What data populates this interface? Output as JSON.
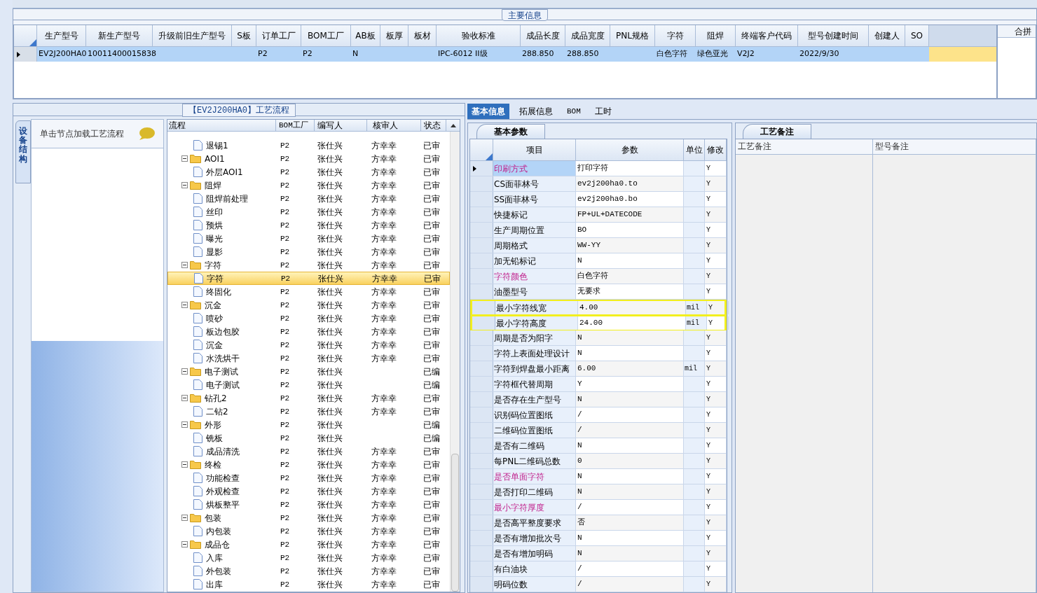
{
  "main_info": {
    "title": "主要信息",
    "columns": [
      {
        "label": "生产型号",
        "value": "EV2J200HA0"
      },
      {
        "label": "新生产型号",
        "value": "10011400015838"
      },
      {
        "label": "升级前旧生产型号"
      },
      {
        "label": "S板"
      },
      {
        "label": "订单工厂",
        "value": "P2"
      },
      {
        "label": "BOM工厂",
        "value": "P2"
      },
      {
        "label": "AB板",
        "value": "N"
      },
      {
        "label": "板厚"
      },
      {
        "label": "板材"
      },
      {
        "label": "验收标准",
        "value": "IPC-6012 II级"
      },
      {
        "label": "成品长度",
        "value": "288.850"
      },
      {
        "label": "成品宽度",
        "value": "288.850"
      },
      {
        "label": "PNL规格"
      },
      {
        "label": "字符",
        "value": "白色字符"
      },
      {
        "label": "阻焊",
        "value": "绿色亚光"
      },
      {
        "label": "终端客户代码",
        "value": "V2J2"
      },
      {
        "label": "型号创建时间",
        "value": "2022/9/30"
      },
      {
        "label": "创建人"
      },
      {
        "label": "SO"
      }
    ],
    "side_column": "合拼"
  },
  "flow_panel": {
    "title": "【EV2J200HA0】工艺流程",
    "side_tab": "设备结构",
    "hint": "单击节点加载工艺流程",
    "columns": [
      "流程",
      "BOM工厂",
      "编写人",
      "核审人",
      "状态"
    ],
    "nodes": [
      {
        "kind": "file",
        "label": "退锡1",
        "bom": "P2",
        "author": "张仕兴",
        "reviewer": "方幸幸",
        "status": "已审",
        "selected": false
      },
      {
        "kind": "folder",
        "label": "AOI1",
        "expanded": true,
        "bom": "P2",
        "author": "张仕兴",
        "reviewer": "方幸幸",
        "status": "已审",
        "selected": false,
        "children": [
          {
            "kind": "file",
            "label": "外层AOI1",
            "bom": "P2",
            "author": "张仕兴",
            "reviewer": "方幸幸",
            "status": "已审",
            "selected": false
          }
        ]
      },
      {
        "kind": "folder",
        "label": "阻焊",
        "expanded": true,
        "bom": "P2",
        "author": "张仕兴",
        "reviewer": "方幸幸",
        "status": "已审",
        "selected": false,
        "children": [
          {
            "kind": "file",
            "label": "阻焊前处理",
            "bom": "P2",
            "author": "张仕兴",
            "reviewer": "方幸幸",
            "status": "已审",
            "selected": false
          },
          {
            "kind": "file",
            "label": "丝印",
            "bom": "P2",
            "author": "张仕兴",
            "reviewer": "方幸幸",
            "status": "已审",
            "selected": false
          },
          {
            "kind": "file",
            "label": "预烘",
            "bom": "P2",
            "author": "张仕兴",
            "reviewer": "方幸幸",
            "status": "已审",
            "selected": false
          },
          {
            "kind": "file",
            "label": "曝光",
            "bom": "P2",
            "author": "张仕兴",
            "reviewer": "方幸幸",
            "status": "已审",
            "selected": false
          },
          {
            "kind": "file",
            "label": "显影",
            "bom": "P2",
            "author": "张仕兴",
            "reviewer": "方幸幸",
            "status": "已审",
            "selected": false
          }
        ]
      },
      {
        "kind": "folder",
        "label": "字符",
        "expanded": true,
        "bom": "P2",
        "author": "张仕兴",
        "reviewer": "方幸幸",
        "status": "已审",
        "selected": false,
        "children": [
          {
            "kind": "file",
            "label": "字符",
            "bom": "P2",
            "author": "张仕兴",
            "reviewer": "方幸幸",
            "status": "已审",
            "selected": true
          },
          {
            "kind": "file",
            "label": "终固化",
            "bom": "P2",
            "author": "张仕兴",
            "reviewer": "方幸幸",
            "status": "已审",
            "selected": false
          }
        ]
      },
      {
        "kind": "folder",
        "label": "沉金",
        "expanded": true,
        "bom": "P2",
        "author": "张仕兴",
        "reviewer": "方幸幸",
        "status": "已审",
        "selected": false,
        "children": [
          {
            "kind": "file",
            "label": "喷砂",
            "bom": "P2",
            "author": "张仕兴",
            "reviewer": "方幸幸",
            "status": "已审",
            "selected": false
          },
          {
            "kind": "file",
            "label": "板边包胶",
            "bom": "P2",
            "author": "张仕兴",
            "reviewer": "方幸幸",
            "status": "已审",
            "selected": false
          },
          {
            "kind": "file",
            "label": "沉金",
            "bom": "P2",
            "author": "张仕兴",
            "reviewer": "方幸幸",
            "status": "已审",
            "selected": false
          },
          {
            "kind": "file",
            "label": "水洗烘干",
            "bom": "P2",
            "author": "张仕兴",
            "reviewer": "方幸幸",
            "status": "已审",
            "selected": false
          }
        ]
      },
      {
        "kind": "folder",
        "label": "电子测试",
        "expanded": true,
        "bom": "P2",
        "author": "张仕兴",
        "status": "已编",
        "selected": false,
        "children": [
          {
            "kind": "file",
            "label": "电子测试",
            "bom": "P2",
            "author": "张仕兴",
            "status": "已编",
            "selected": false
          }
        ]
      },
      {
        "kind": "folder",
        "label": "钻孔2",
        "expanded": true,
        "bom": "P2",
        "author": "张仕兴",
        "reviewer": "方幸幸",
        "status": "已审",
        "selected": false,
        "children": [
          {
            "kind": "file",
            "label": "二钻2",
            "bom": "P2",
            "author": "张仕兴",
            "reviewer": "方幸幸",
            "status": "已审",
            "selected": false
          }
        ]
      },
      {
        "kind": "folder",
        "label": "外形",
        "expanded": true,
        "bom": "P2",
        "author": "张仕兴",
        "status": "已编",
        "selected": false,
        "children": [
          {
            "kind": "file",
            "label": "铣板",
            "bom": "P2",
            "author": "张仕兴",
            "status": "已编",
            "selected": false
          },
          {
            "kind": "file",
            "label": "成品清洗",
            "bom": "P2",
            "author": "张仕兴",
            "reviewer": "方幸幸",
            "status": "已审",
            "selected": false
          }
        ]
      },
      {
        "kind": "folder",
        "label": "终检",
        "expanded": true,
        "bom": "P2",
        "author": "张仕兴",
        "reviewer": "方幸幸",
        "status": "已审",
        "selected": false,
        "children": [
          {
            "kind": "file",
            "label": "功能检查",
            "bom": "P2",
            "author": "张仕兴",
            "reviewer": "方幸幸",
            "status": "已审",
            "selected": false
          },
          {
            "kind": "file",
            "label": "外观检查",
            "bom": "P2",
            "author": "张仕兴",
            "reviewer": "方幸幸",
            "status": "已审",
            "selected": false
          },
          {
            "kind": "file",
            "label": "烘板整平",
            "bom": "P2",
            "author": "张仕兴",
            "reviewer": "方幸幸",
            "status": "已审",
            "selected": false
          }
        ]
      },
      {
        "kind": "folder",
        "label": "包装",
        "expanded": true,
        "bom": "P2",
        "author": "张仕兴",
        "reviewer": "方幸幸",
        "status": "已审",
        "selected": false,
        "children": [
          {
            "kind": "file",
            "label": "内包装",
            "bom": "P2",
            "author": "张仕兴",
            "reviewer": "方幸幸",
            "status": "已审",
            "selected": false
          }
        ]
      },
      {
        "kind": "folder",
        "label": "成品仓",
        "expanded": true,
        "bom": "P2",
        "author": "张仕兴",
        "reviewer": "方幸幸",
        "status": "已审",
        "selected": false,
        "children": [
          {
            "kind": "file",
            "label": "入库",
            "bom": "P2",
            "author": "张仕兴",
            "reviewer": "方幸幸",
            "status": "已审",
            "selected": false
          },
          {
            "kind": "file",
            "label": "外包装",
            "bom": "P2",
            "author": "张仕兴",
            "reviewer": "方幸幸",
            "status": "已审",
            "selected": false
          },
          {
            "kind": "file",
            "label": "出库",
            "bom": "P2",
            "author": "张仕兴",
            "reviewer": "方幸幸",
            "status": "已审",
            "selected": false
          }
        ]
      }
    ]
  },
  "detail_tabs": [
    {
      "label": "基本信息",
      "selected": true
    },
    {
      "label": "拓展信息",
      "selected": false
    },
    {
      "label": "BOM",
      "selected": false
    },
    {
      "label": "工时",
      "selected": false
    }
  ],
  "params": {
    "tab": "基本参数",
    "columns": [
      "项目",
      "参数",
      "单位",
      "修改"
    ],
    "rows": [
      {
        "item": "印刷方式",
        "emphasized": true,
        "value": "打印字符",
        "edit": "Y",
        "selected": true,
        "highlighted": false
      },
      {
        "item": "CS面菲林号",
        "emphasized": false,
        "value": "ev2j200ha0.to",
        "edit": "Y",
        "selected": false,
        "highlighted": false
      },
      {
        "item": "SS面菲林号",
        "emphasized": false,
        "value": "ev2j200ha0.bo",
        "edit": "Y",
        "selected": false,
        "highlighted": false
      },
      {
        "item": "快捷标记",
        "emphasized": false,
        "value": "FP+UL+DATECODE",
        "edit": "Y",
        "selected": false,
        "highlighted": false
      },
      {
        "item": "生产周期位置",
        "emphasized": false,
        "value": "BO",
        "edit": "Y",
        "selected": false,
        "highlighted": false
      },
      {
        "item": "周期格式",
        "emphasized": false,
        "value": "WW-YY",
        "edit": "Y",
        "selected": false,
        "highlighted": false
      },
      {
        "item": "加无铅标记",
        "emphasized": false,
        "value": "N",
        "edit": "Y",
        "selected": false,
        "highlighted": false
      },
      {
        "item": "字符颜色",
        "emphasized": true,
        "value": "白色字符",
        "edit": "Y",
        "selected": false,
        "highlighted": false
      },
      {
        "item": "油墨型号",
        "emphasized": false,
        "value": "无要求",
        "edit": "Y",
        "selected": false,
        "highlighted": false
      },
      {
        "item": "最小字符线宽",
        "emphasized": false,
        "value": "4.00",
        "unit": "mil",
        "edit": "Y",
        "selected": false,
        "highlighted": true
      },
      {
        "item": "最小字符高度",
        "emphasized": false,
        "value": "24.00",
        "unit": "mil",
        "edit": "Y",
        "selected": false,
        "highlighted": true
      },
      {
        "item": "周期是否为阳字",
        "emphasized": false,
        "value": "N",
        "edit": "Y",
        "selected": false,
        "highlighted": false
      },
      {
        "item": "字符上表面处理设计",
        "emphasized": false,
        "value": "N",
        "edit": "Y",
        "selected": false,
        "highlighted": false
      },
      {
        "item": "字符到焊盘最小距离",
        "emphasized": false,
        "value": "6.00",
        "unit": "mil",
        "edit": "Y",
        "selected": false,
        "highlighted": false
      },
      {
        "item": "字符框代替周期",
        "emphasized": false,
        "value": "Y",
        "edit": "Y",
        "selected": false,
        "highlighted": false
      },
      {
        "item": "是否存在生产型号",
        "emphasized": false,
        "value": "N",
        "edit": "Y",
        "selected": false,
        "highlighted": false
      },
      {
        "item": "识别码位置图纸",
        "emphasized": false,
        "value": "/",
        "edit": "Y",
        "selected": false,
        "highlighted": false
      },
      {
        "item": "二维码位置图纸",
        "emphasized": false,
        "value": "/",
        "edit": "Y",
        "selected": false,
        "highlighted": false
      },
      {
        "item": "是否有二维码",
        "emphasized": false,
        "value": "N",
        "edit": "Y",
        "selected": false,
        "highlighted": false
      },
      {
        "item": "每PNL二维码总数",
        "emphasized": false,
        "value": "0",
        "edit": "Y",
        "selected": false,
        "highlighted": false
      },
      {
        "item": "是否单面字符",
        "emphasized": true,
        "value": "N",
        "edit": "Y",
        "selected": false,
        "highlighted": false
      },
      {
        "item": "是否打印二维码",
        "emphasized": false,
        "value": "N",
        "edit": "Y",
        "selected": false,
        "highlighted": false
      },
      {
        "item": "最小字符厚度",
        "emphasized": true,
        "value": "/",
        "edit": "Y",
        "selected": false,
        "highlighted": false
      },
      {
        "item": "是否高平整度要求",
        "emphasized": false,
        "value": "否",
        "edit": "Y",
        "selected": false,
        "highlighted": false
      },
      {
        "item": "是否有增加批次号",
        "emphasized": false,
        "value": "N",
        "edit": "Y",
        "selected": false,
        "highlighted": false
      },
      {
        "item": "是否有增加明码",
        "emphasized": false,
        "value": "N",
        "edit": "Y",
        "selected": false,
        "highlighted": false
      },
      {
        "item": "有白油块",
        "emphasized": false,
        "value": "/",
        "edit": "Y",
        "selected": false,
        "highlighted": false
      },
      {
        "item": "明码位数",
        "emphasized": false,
        "value": "/",
        "edit": "Y",
        "selected": false,
        "highlighted": false
      }
    ]
  },
  "remarks": {
    "tab": "工艺备注",
    "columns": [
      "工艺备注",
      "型号备注"
    ]
  }
}
